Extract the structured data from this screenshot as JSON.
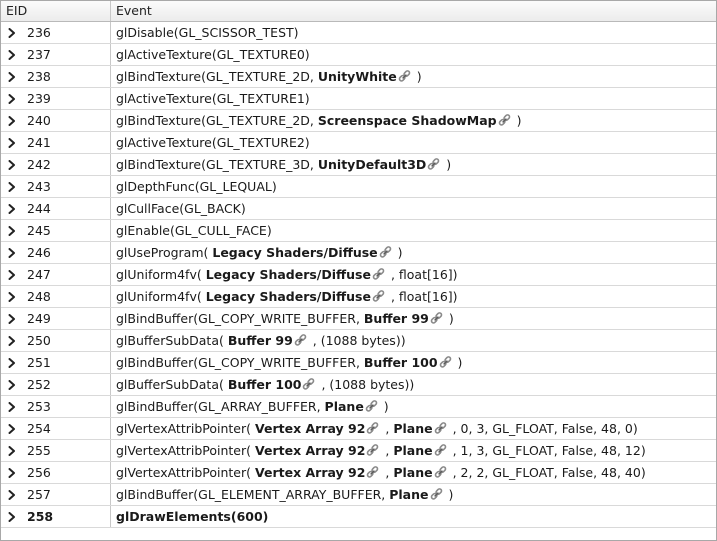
{
  "header": {
    "eid": "EID",
    "event": "Event"
  },
  "rows": [
    {
      "eid": "236",
      "parts": [
        {
          "t": "glDisable(GL_SCISSOR_TEST)"
        }
      ]
    },
    {
      "eid": "237",
      "parts": [
        {
          "t": "glActiveTexture(GL_TEXTURE0)"
        }
      ]
    },
    {
      "eid": "238",
      "parts": [
        {
          "t": "glBindTexture(GL_TEXTURE_2D, "
        },
        {
          "t": "UnityWhite",
          "b": true
        },
        {
          "icon": true
        },
        {
          "t": " )"
        }
      ]
    },
    {
      "eid": "239",
      "parts": [
        {
          "t": "glActiveTexture(GL_TEXTURE1)"
        }
      ]
    },
    {
      "eid": "240",
      "parts": [
        {
          "t": "glBindTexture(GL_TEXTURE_2D, "
        },
        {
          "t": "Screenspace ShadowMap",
          "b": true
        },
        {
          "icon": true
        },
        {
          "t": " )"
        }
      ]
    },
    {
      "eid": "241",
      "parts": [
        {
          "t": "glActiveTexture(GL_TEXTURE2)"
        }
      ]
    },
    {
      "eid": "242",
      "parts": [
        {
          "t": "glBindTexture(GL_TEXTURE_3D, "
        },
        {
          "t": "UnityDefault3D",
          "b": true
        },
        {
          "icon": true
        },
        {
          "t": " )"
        }
      ]
    },
    {
      "eid": "243",
      "parts": [
        {
          "t": "glDepthFunc(GL_LEQUAL)"
        }
      ]
    },
    {
      "eid": "244",
      "parts": [
        {
          "t": "glCullFace(GL_BACK)"
        }
      ]
    },
    {
      "eid": "245",
      "parts": [
        {
          "t": "glEnable(GL_CULL_FACE)"
        }
      ]
    },
    {
      "eid": "246",
      "parts": [
        {
          "t": "glUseProgram( "
        },
        {
          "t": "Legacy Shaders/Diffuse",
          "b": true
        },
        {
          "icon": true
        },
        {
          "t": " )"
        }
      ]
    },
    {
      "eid": "247",
      "parts": [
        {
          "t": "glUniform4fv( "
        },
        {
          "t": "Legacy Shaders/Diffuse",
          "b": true
        },
        {
          "icon": true
        },
        {
          "t": " , float[16])"
        }
      ]
    },
    {
      "eid": "248",
      "parts": [
        {
          "t": "glUniform4fv( "
        },
        {
          "t": "Legacy Shaders/Diffuse",
          "b": true
        },
        {
          "icon": true
        },
        {
          "t": " , float[16])"
        }
      ]
    },
    {
      "eid": "249",
      "parts": [
        {
          "t": "glBindBuffer(GL_COPY_WRITE_BUFFER, "
        },
        {
          "t": "Buffer 99",
          "b": true
        },
        {
          "icon": true
        },
        {
          "t": " )"
        }
      ]
    },
    {
      "eid": "250",
      "parts": [
        {
          "t": "glBufferSubData( "
        },
        {
          "t": "Buffer 99",
          "b": true
        },
        {
          "icon": true
        },
        {
          "t": " , (1088 bytes))"
        }
      ]
    },
    {
      "eid": "251",
      "parts": [
        {
          "t": "glBindBuffer(GL_COPY_WRITE_BUFFER, "
        },
        {
          "t": "Buffer 100",
          "b": true
        },
        {
          "icon": true
        },
        {
          "t": " )"
        }
      ]
    },
    {
      "eid": "252",
      "parts": [
        {
          "t": "glBufferSubData( "
        },
        {
          "t": "Buffer 100",
          "b": true
        },
        {
          "icon": true
        },
        {
          "t": " , (1088 bytes))"
        }
      ]
    },
    {
      "eid": "253",
      "parts": [
        {
          "t": "glBindBuffer(GL_ARRAY_BUFFER, "
        },
        {
          "t": "Plane",
          "b": true
        },
        {
          "icon": true
        },
        {
          "t": " )"
        }
      ]
    },
    {
      "eid": "254",
      "parts": [
        {
          "t": "glVertexAttribPointer( "
        },
        {
          "t": "Vertex Array 92",
          "b": true
        },
        {
          "icon": true
        },
        {
          "t": " , "
        },
        {
          "t": "Plane",
          "b": true
        },
        {
          "icon": true
        },
        {
          "t": " , 0, 3, GL_FLOAT, False, 48, 0)"
        }
      ]
    },
    {
      "eid": "255",
      "parts": [
        {
          "t": "glVertexAttribPointer( "
        },
        {
          "t": "Vertex Array 92",
          "b": true
        },
        {
          "icon": true
        },
        {
          "t": " , "
        },
        {
          "t": "Plane",
          "b": true
        },
        {
          "icon": true
        },
        {
          "t": " , 1, 3, GL_FLOAT, False, 48, 12)"
        }
      ]
    },
    {
      "eid": "256",
      "parts": [
        {
          "t": "glVertexAttribPointer( "
        },
        {
          "t": "Vertex Array 92",
          "b": true
        },
        {
          "icon": true
        },
        {
          "t": " , "
        },
        {
          "t": "Plane",
          "b": true
        },
        {
          "icon": true
        },
        {
          "t": " , 2, 2, GL_FLOAT, False, 48, 40)"
        }
      ]
    },
    {
      "eid": "257",
      "parts": [
        {
          "t": "glBindBuffer(GL_ELEMENT_ARRAY_BUFFER, "
        },
        {
          "t": "Plane",
          "b": true
        },
        {
          "icon": true
        },
        {
          "t": " )"
        }
      ]
    },
    {
      "eid": "258",
      "selected": true,
      "parts": [
        {
          "t": "glDrawElements(600)"
        }
      ]
    }
  ],
  "icons": {
    "expand": "chevron-right-icon",
    "resource_link": "link-icon"
  },
  "colors": {
    "row_border": "#d9d9d9",
    "header_bg": "#f2f2f2",
    "link_icon": "#8a8a8a"
  }
}
